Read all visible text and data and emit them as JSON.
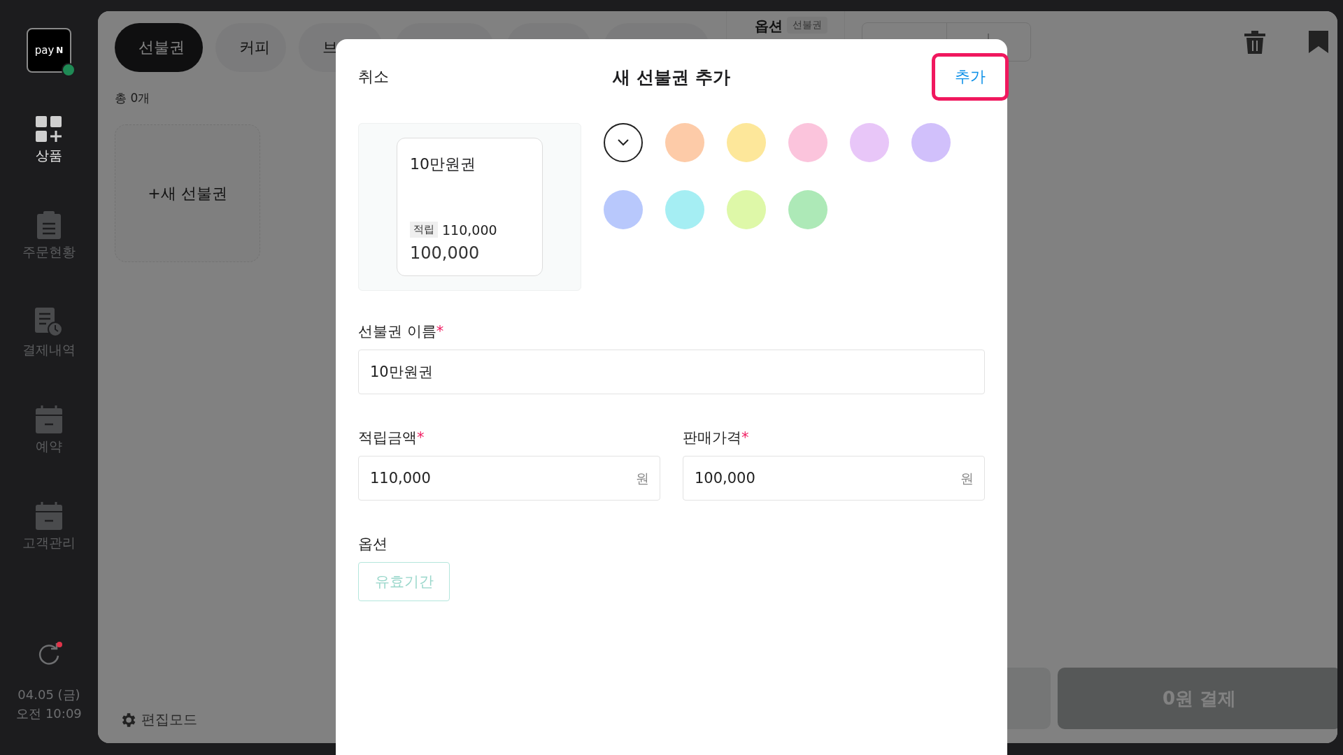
{
  "sidebar": {
    "logo": {
      "text": "pay",
      "mark": "N",
      "online": true
    },
    "items": [
      {
        "label": "상품",
        "selected": true
      },
      {
        "label": "주문현황",
        "selected": false
      },
      {
        "label": "결제내역",
        "selected": false
      },
      {
        "label": "예약",
        "selected": false
      },
      {
        "label": "고객관리",
        "selected": false
      }
    ],
    "sync": {
      "alert": true
    },
    "date": "04.05 (금)",
    "time": "오전 10:09"
  },
  "category_tabs": [
    {
      "label": "선불권",
      "selected": true
    },
    {
      "label": "커피",
      "selected": false
    },
    {
      "label": "브",
      "selected": false
    },
    {
      "selected": false
    },
    {
      "selected": false
    },
    {
      "selected": false
    }
  ],
  "product_count": "총 0개",
  "new_card": "+새 선불권",
  "edit_mode": "편집모드",
  "options_header": {
    "title": "옵션",
    "tag": "선불권"
  },
  "pay_button": "0원 결제",
  "modal": {
    "cancel": "취소",
    "title": "새 선불권 추가",
    "confirm": "추가",
    "preview": {
      "name": "10만원권",
      "badge": "적립",
      "points": "110,000",
      "price": "100,000"
    },
    "colors": [
      {
        "color": "#ffffff",
        "selected": true
      },
      {
        "color": "#fdcba8",
        "selected": false
      },
      {
        "color": "#fde79a",
        "selected": false
      },
      {
        "color": "#fbc4dc",
        "selected": false
      },
      {
        "color": "#e8c6f8",
        "selected": false
      },
      {
        "color": "#d1c0fb",
        "selected": false
      },
      {
        "color": "#b8c8fc",
        "selected": false
      },
      {
        "color": "#a5eef3",
        "selected": false
      },
      {
        "color": "#def8a8",
        "selected": false
      },
      {
        "color": "#ade9b7",
        "selected": false
      }
    ],
    "name_field": {
      "label": "선불권 이름",
      "required_mark": "*",
      "value": "10만원권"
    },
    "points_field": {
      "label": "적립금액",
      "required_mark": "*",
      "value": "110,000",
      "unit": "원"
    },
    "price_field": {
      "label": "판매가격",
      "required_mark": "*",
      "value": "100,000",
      "unit": "원"
    },
    "options": {
      "label": "옵션",
      "chips": [
        {
          "label": "유효기간",
          "selected": false
        }
      ]
    }
  }
}
